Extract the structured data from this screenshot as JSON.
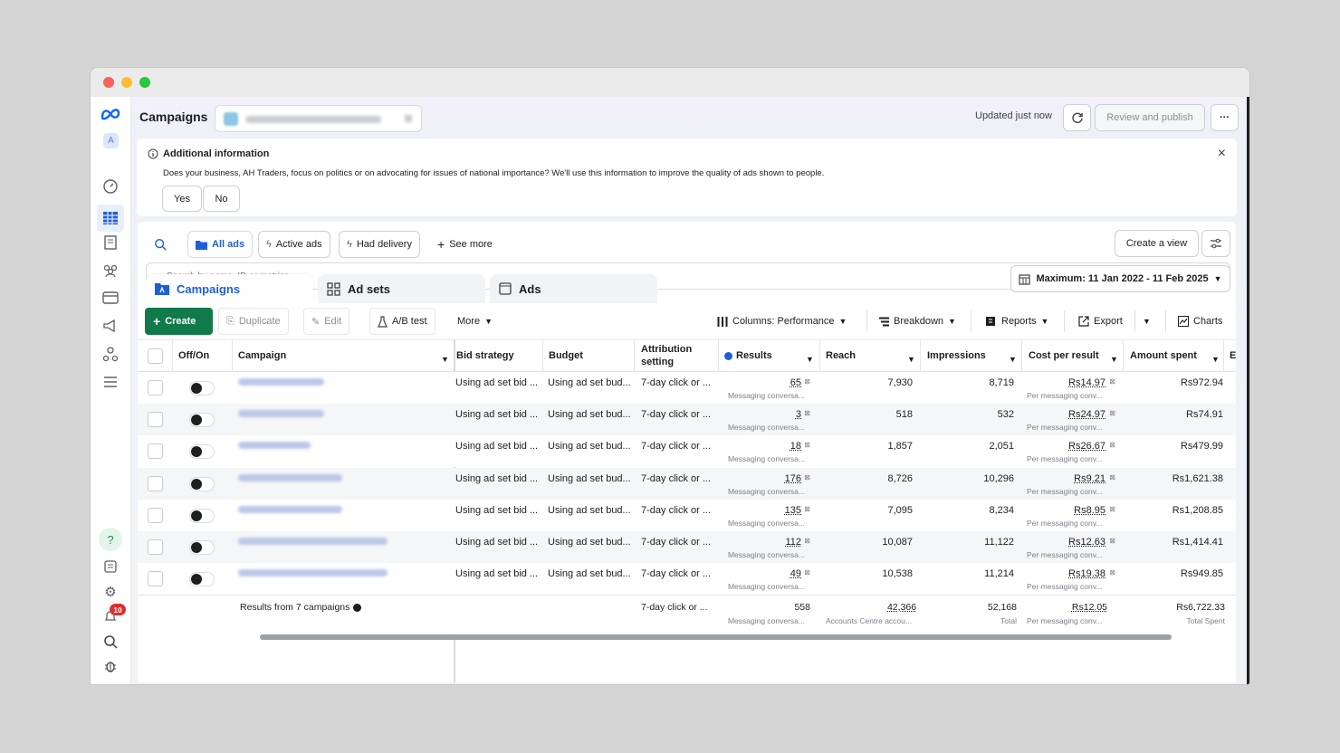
{
  "header": {
    "title": "Campaigns",
    "updated": "Updated just now",
    "review": "Review and publish",
    "more": "···"
  },
  "rail": {
    "avatar": "A",
    "notif_count": "10"
  },
  "info": {
    "title": "Additional information",
    "text": "Does your business, AH Traders, focus on politics or on advocating for issues of national importance? We'll use this information to improve the quality of ads shown to people.",
    "yes": "Yes",
    "no": "No"
  },
  "filters": {
    "all": "All ads",
    "active": "Active ads",
    "delivery": "Had delivery",
    "see_more": "See more",
    "create_view": "Create a view",
    "search_placeholder": "Search by name, ID or metrics"
  },
  "tabs": [
    "Campaigns",
    "Ad sets",
    "Ads"
  ],
  "date_range": "Maximum: 11 Jan 2022 - 11 Feb 2025",
  "toolbar": {
    "create": "Create",
    "duplicate": "Duplicate",
    "edit": "Edit",
    "ab": "A/B test",
    "more": "More",
    "columns": "Columns: Performance",
    "breakdown": "Breakdown",
    "reports": "Reports",
    "export": "Export",
    "charts": "Charts"
  },
  "table": {
    "headers": {
      "offon": "Off/On",
      "campaign": "Campaign",
      "bid": "Bid strategy",
      "budget": "Budget",
      "attr1": "Attribution",
      "attr2": "setting",
      "results": "Results",
      "reach": "Reach",
      "impressions": "Impressions",
      "cpr": "Cost per result",
      "spent": "Amount spent",
      "extra": "E"
    },
    "rows": [
      {
        "bid": "Using ad set bid ...",
        "budget": "Using ad set bud...",
        "attr": "7-day click or ...",
        "results": "65",
        "results_sub": "Messaging conversa...",
        "reach": "7,930",
        "impressions": "8,719",
        "cpr": "Rs14.97",
        "cpr_sub": "Per messaging conv...",
        "spent": "Rs972.94"
      },
      {
        "bid": "Using ad set bid ...",
        "budget": "Using ad set bud...",
        "attr": "7-day click or ...",
        "results": "3",
        "results_sub": "Messaging conversa...",
        "reach": "518",
        "impressions": "532",
        "cpr": "Rs24.97",
        "cpr_sub": "Per messaging conv...",
        "spent": "Rs74.91"
      },
      {
        "bid": "Using ad set bid ...",
        "budget": "Using ad set bud...",
        "attr": "7-day click or ...",
        "results": "18",
        "results_sub": "Messaging conversa...",
        "reach": "1,857",
        "impressions": "2,051",
        "cpr": "Rs26.67",
        "cpr_sub": "Per messaging conv...",
        "spent": "Rs479.99"
      },
      {
        "bid": "Using ad set bid ...",
        "budget": "Using ad set bud...",
        "attr": "7-day click or ...",
        "results": "176",
        "results_sub": "Messaging conversa...",
        "reach": "8,726",
        "impressions": "10,296",
        "cpr": "Rs9.21",
        "cpr_sub": "Per messaging conv...",
        "spent": "Rs1,621.38"
      },
      {
        "bid": "Using ad set bid ...",
        "budget": "Using ad set bud...",
        "attr": "7-day click or ...",
        "results": "135",
        "results_sub": "Messaging conversa...",
        "reach": "7,095",
        "impressions": "8,234",
        "cpr": "Rs8.95",
        "cpr_sub": "Per messaging conv...",
        "spent": "Rs1,208.85"
      },
      {
        "bid": "Using ad set bid ...",
        "budget": "Using ad set bud...",
        "attr": "7-day click or ...",
        "results": "112",
        "results_sub": "Messaging conversa...",
        "reach": "10,087",
        "impressions": "11,122",
        "cpr": "Rs12.63",
        "cpr_sub": "Per messaging conv...",
        "spent": "Rs1,414.41"
      },
      {
        "bid": "Using ad set bid ...",
        "budget": "Using ad set bud...",
        "attr": "7-day click or ...",
        "results": "49",
        "results_sub": "Messaging conversa...",
        "reach": "10,538",
        "impressions": "11,214",
        "cpr": "Rs19.38",
        "cpr_sub": "Per messaging conv...",
        "spent": "Rs949.85"
      }
    ],
    "totals": {
      "label": "Results from 7 campaigns",
      "attr": "7-day click or ...",
      "results": "558",
      "results_sub": "Messaging conversa...",
      "reach": "42,366",
      "reach_sub": "Accounts Centre accou...",
      "impressions": "52,168",
      "impressions_sub": "Total",
      "cpr": "Rs12.05",
      "cpr_sub": "Per messaging conv...",
      "spent": "Rs6,722.33",
      "spent_sub": "Total Spent"
    }
  }
}
